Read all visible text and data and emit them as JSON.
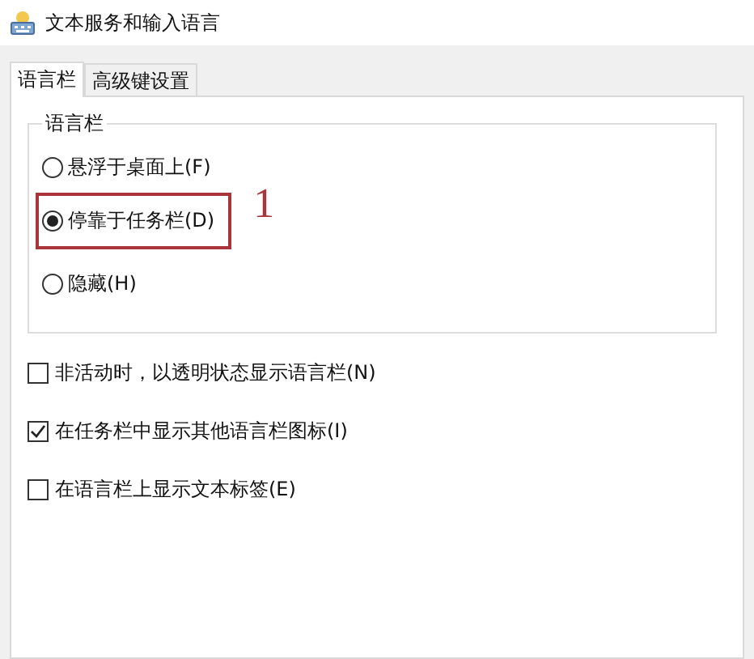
{
  "window": {
    "title": "文本服务和输入语言"
  },
  "tabs": [
    {
      "label": "语言栏",
      "selected": true
    },
    {
      "label": "高级键设置",
      "selected": false
    }
  ],
  "language_bar_group": {
    "title": "语言栏",
    "options": [
      {
        "label": "悬浮于桌面上(F)",
        "selected": false,
        "highlighted": false
      },
      {
        "label": "停靠于任务栏(D)",
        "selected": true,
        "highlighted": true
      },
      {
        "label": "隐藏(H)",
        "selected": false,
        "highlighted": false
      }
    ]
  },
  "annotation": {
    "label": "1"
  },
  "checkboxes": [
    {
      "label": "非活动时，以透明状态显示语言栏(N)",
      "checked": false
    },
    {
      "label": "在任务栏中显示其他语言栏图标(I)",
      "checked": true
    },
    {
      "label": "在语言栏上显示文本标签(E)",
      "checked": false
    }
  ]
}
